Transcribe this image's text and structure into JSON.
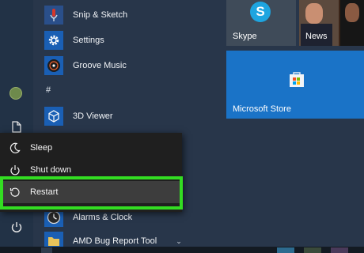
{
  "apps": [
    {
      "label": "Snip & Sketch",
      "icon": "snip-sketch-icon"
    },
    {
      "label": "Settings",
      "icon": "gear-icon"
    },
    {
      "label": "Groove Music",
      "icon": "groove-music-icon"
    },
    {
      "label": "3D Viewer",
      "icon": "cube-icon"
    },
    {
      "label": "Alarms & Clock",
      "icon": "clock-icon"
    },
    {
      "label": "AMD Bug Report Tool",
      "icon": "folder-icon"
    }
  ],
  "section_letter": "#",
  "tiles": {
    "skype": "Skype",
    "news": "News",
    "store": "Microsoft Store"
  },
  "power_menu": {
    "items": [
      {
        "label": "Sleep",
        "icon": "moon-icon"
      },
      {
        "label": "Shut down",
        "icon": "power-icon"
      },
      {
        "label": "Restart",
        "icon": "restart-icon"
      }
    ]
  },
  "colors": {
    "background": "#28364a",
    "accent_blue": "#1a73c7",
    "highlight": "#33dd22",
    "power_menu_bg": "#1f1f1f"
  }
}
